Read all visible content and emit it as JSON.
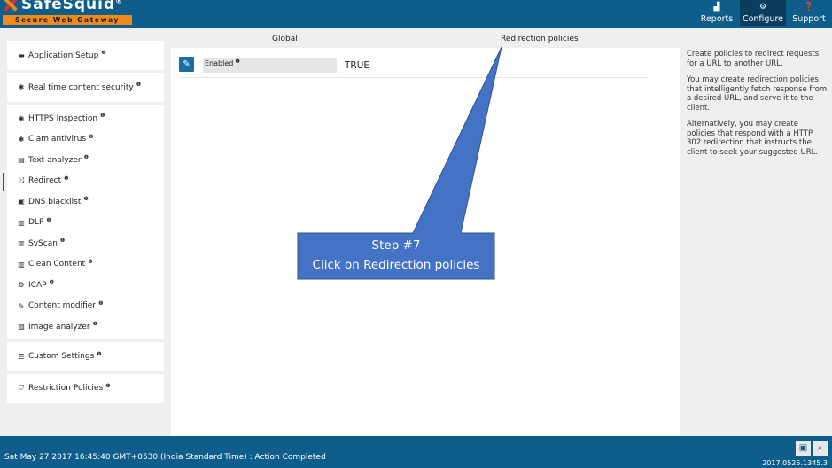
{
  "logo": {
    "name": "SafeSquid",
    "reg": "®",
    "tagline": "Secure Web Gateway"
  },
  "topnav": [
    {
      "label": "Reports",
      "icon": "bar-chart-icon"
    },
    {
      "label": "Configure",
      "icon": "cogs-icon",
      "active": true
    },
    {
      "label": "Support",
      "icon": "question-icon"
    }
  ],
  "sidebar": {
    "groups": [
      {
        "items": [
          {
            "label": "Application Setup",
            "icon": "briefcase-icon"
          }
        ]
      },
      {
        "items": [
          {
            "label": "Real time content security",
            "icon": "spider-icon"
          }
        ]
      },
      {
        "items": [
          {
            "label": "HTTPS Inspection",
            "icon": "eye-icon"
          },
          {
            "label": "Clam antivirus",
            "icon": "asterisk-icon"
          },
          {
            "label": "Text analyzer",
            "icon": "document-icon"
          },
          {
            "label": "Redirect",
            "icon": "shuffle-icon",
            "active": true
          },
          {
            "label": "DNS blacklist",
            "icon": "dns-icon"
          },
          {
            "label": "DLP",
            "icon": "barcode-icon"
          },
          {
            "label": "SvScan",
            "icon": "barcode-icon"
          },
          {
            "label": "Clean Content",
            "icon": "barcode-icon"
          },
          {
            "label": "ICAP",
            "icon": "gear-icon"
          },
          {
            "label": "Content modifier",
            "icon": "edit-icon"
          },
          {
            "label": "Image analyzer",
            "icon": "image-icon"
          }
        ]
      },
      {
        "items": [
          {
            "label": "Custom Settings",
            "icon": "sliders-icon"
          }
        ]
      },
      {
        "items": [
          {
            "label": "Restriction Policies",
            "icon": "shield-icon"
          }
        ]
      }
    ]
  },
  "tabs": {
    "global": "Global",
    "redirection": "Redirection policies"
  },
  "field": {
    "label": "Enabled",
    "value": "TRUE"
  },
  "help": [
    "Create policies to redirect requests for a URL to another URL.",
    "You may create redirection policies that intelligently fetch response from a desired URL, and serve it to the client.",
    "Alternatively, you may create policies that respond with a HTTP 302 redirection that instructs the client to seek your suggested URL."
  ],
  "callout": {
    "line1": "Step #7",
    "line2": "Click on Redirection policies",
    "color": "#4472c4"
  },
  "footer": {
    "status": "Sat May 27 2017 16:45:40 GMT+0530 (India Standard Time) : Action Completed",
    "version": "2017.0525.1345.3"
  },
  "colors": {
    "brand": "#0f5d8a",
    "accent": "#f08a1c"
  }
}
